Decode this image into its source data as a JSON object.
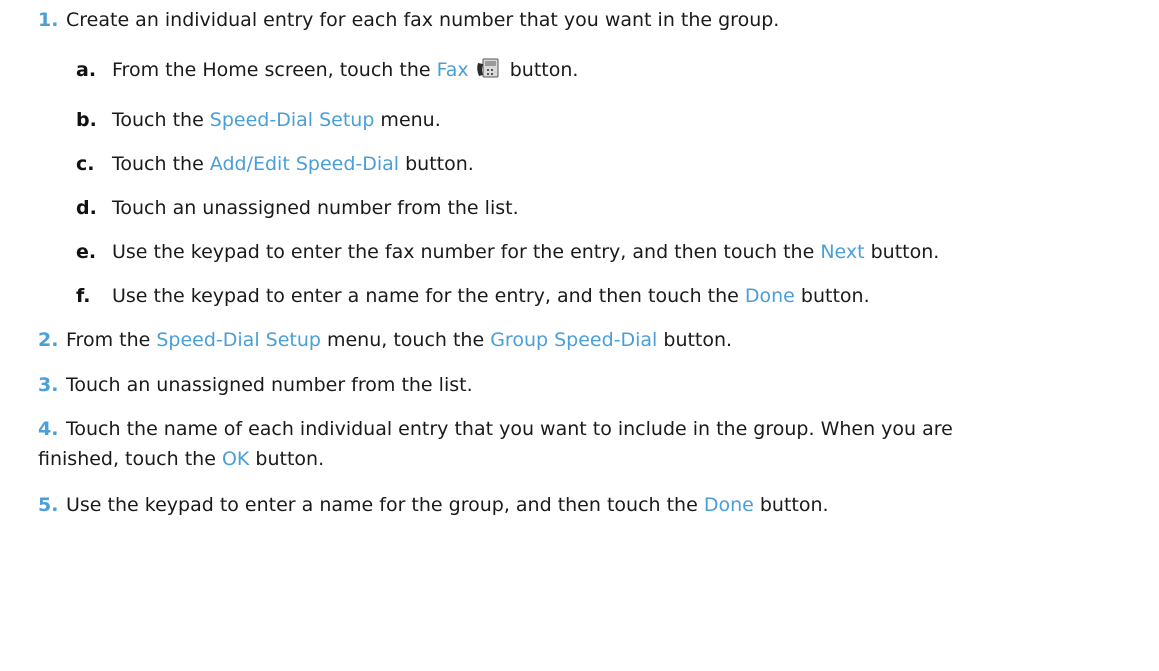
{
  "steps": [
    {
      "number": "1.",
      "text": "Create an individual entry for each fax number that you want in the group.",
      "substeps": [
        {
          "letter": "a.",
          "t1": "From the Home screen, touch the ",
          "k1": "Fax",
          "t2": " button.",
          "icon": "fax-icon"
        },
        {
          "letter": "b.",
          "t1": "Touch the ",
          "k1": "Speed-Dial Setup",
          "t2": " menu."
        },
        {
          "letter": "c.",
          "t1": "Touch the ",
          "k1": "Add/Edit Speed-Dial",
          "t2": " button."
        },
        {
          "letter": "d.",
          "t1": "Touch an unassigned number from the list."
        },
        {
          "letter": "e.",
          "t1": "Use the keypad to enter the fax number for the entry, and then touch the ",
          "k1": "Next",
          "t2": " button."
        },
        {
          "letter": "f.",
          "t1": "Use the keypad to enter a name for the entry, and then touch the ",
          "k1": "Done",
          "t2": " button."
        }
      ]
    },
    {
      "number": "2.",
      "t1": "From the ",
      "k1": "Speed-Dial Setup",
      "t2": " menu, touch the ",
      "k2": "Group Speed-Dial",
      "t3": " button."
    },
    {
      "number": "3.",
      "t1": "Touch an unassigned number from the list."
    },
    {
      "number": "4.",
      "t1": "Touch the name of each individual entry that you want to include in the group. When you are",
      "t2": "finished, touch the ",
      "k1": "OK",
      "t3": " button."
    },
    {
      "number": "5.",
      "t1": "Use the keypad to enter a name for the group, and then touch the ",
      "k1": "Done",
      "t2": " button."
    }
  ],
  "colors": {
    "step_number": "#4a9fd8",
    "keyword": "#4a9fd8",
    "text": "#1a1a1a"
  }
}
